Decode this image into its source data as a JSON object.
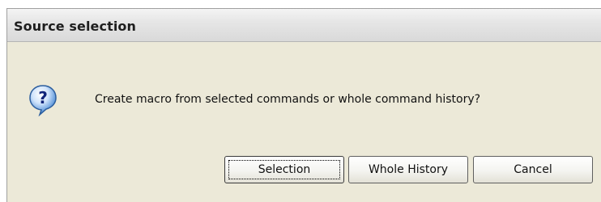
{
  "dialog": {
    "title": "Source selection",
    "icon": "question-icon",
    "message": "Create macro from selected commands or whole command history?",
    "buttons": {
      "selection": "Selection",
      "whole_history": "Whole History",
      "cancel": "Cancel"
    },
    "focused_button": "selection"
  },
  "colors": {
    "dialog_background": "#ece9d8",
    "icon_bubble": "#3a7fd0",
    "icon_glyph": "#10247a"
  }
}
